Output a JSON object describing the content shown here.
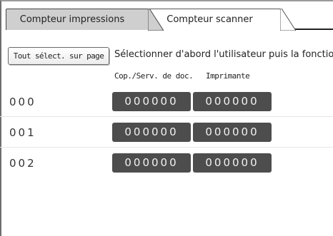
{
  "tabs": [
    {
      "label": "Compteur impressions",
      "active": true
    },
    {
      "label": "Compteur scanner",
      "active": false
    }
  ],
  "toolbar": {
    "select_all_label": "Tout sélect. sur page",
    "instruction": "Sélectionner d'abord l'utilisateur puis la fonction."
  },
  "columns": {
    "copy_doc": "Cop./Serv. de doc.",
    "printer": "Imprimante"
  },
  "rows": [
    {
      "id": "000",
      "copy_doc": "000000",
      "printer": "000000"
    },
    {
      "id": "001",
      "copy_doc": "000000",
      "printer": "000000"
    },
    {
      "id": "002",
      "copy_doc": "000000",
      "printer": "000000"
    }
  ],
  "colors": {
    "counter_bg": "#4d4d4d",
    "active_tab_bg": "#cfcfcf"
  }
}
